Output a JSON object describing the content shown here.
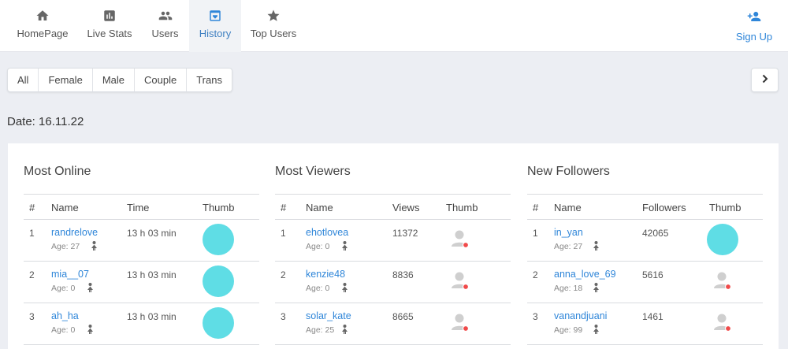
{
  "nav": {
    "items": [
      {
        "label": "HomePage",
        "icon": "home-icon"
      },
      {
        "label": "Live Stats",
        "icon": "chart-icon"
      },
      {
        "label": "Users",
        "icon": "users-icon"
      },
      {
        "label": "History",
        "icon": "archive-icon",
        "active": true
      },
      {
        "label": "Top Users",
        "icon": "star-icon"
      }
    ],
    "signup": {
      "label": "Sign Up",
      "icon": "add-user-icon"
    }
  },
  "filters": [
    "All",
    "Female",
    "Male",
    "Couple",
    "Trans"
  ],
  "date_label": "Date: 16.11.22",
  "sections": {
    "online": {
      "title": "Most Online",
      "headers": [
        "#",
        "Name",
        "Time",
        "Thumb"
      ],
      "rows": [
        {
          "num": "1",
          "name": "randrelove",
          "age": "Age: 27",
          "value": "13 h 03 min"
        },
        {
          "num": "2",
          "name": "mia__07",
          "age": "Age: 0",
          "value": "13 h 03 min"
        },
        {
          "num": "3",
          "name": "ah_ha",
          "age": "Age: 0",
          "value": "13 h 03 min"
        }
      ]
    },
    "viewers": {
      "title": "Most Viewers",
      "headers": [
        "#",
        "Name",
        "Views",
        "Thumb"
      ],
      "rows": [
        {
          "num": "1",
          "name": "ehotlovea",
          "age": "Age: 0",
          "value": "11372"
        },
        {
          "num": "2",
          "name": "kenzie48",
          "age": "Age: 0",
          "value": "8836"
        },
        {
          "num": "3",
          "name": "solar_kate",
          "age": "Age: 25",
          "value": "8665"
        }
      ]
    },
    "followers": {
      "title": "New Followers",
      "headers": [
        "#",
        "Name",
        "Followers",
        "Thumb"
      ],
      "rows": [
        {
          "num": "1",
          "name": "in_yan",
          "age": "Age: 27",
          "value": "42065"
        },
        {
          "num": "2",
          "name": "anna_love_69",
          "age": "Age: 18",
          "value": "5616"
        },
        {
          "num": "3",
          "name": "vanandjuani",
          "age": "Age: 99",
          "value": "1461"
        }
      ]
    }
  },
  "colors": {
    "accent": "#2f86d9",
    "thumb_blob": "#5fdde5",
    "offline_dot": "#f04a4a"
  }
}
